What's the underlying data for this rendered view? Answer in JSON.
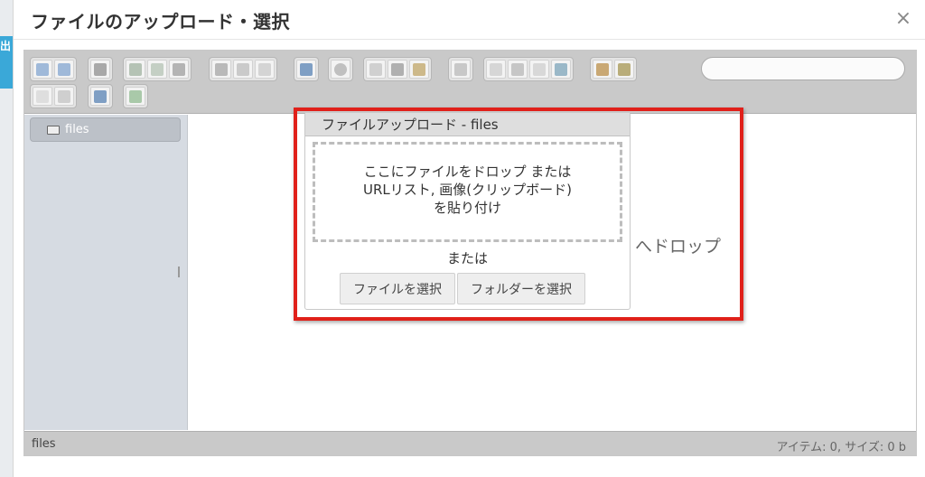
{
  "page": {
    "left_tab_text": "出"
  },
  "dialog": {
    "title": "ファイルのアップロード・選択",
    "close_label": "×"
  },
  "toolbar": {
    "search": {
      "value": "",
      "placeholder": ""
    },
    "groups": [
      [
        "back-icon",
        "forward-icon"
      ],
      [
        "home-icon"
      ],
      [
        "open-icon",
        "new-file-icon",
        "save-icon"
      ],
      [
        "view-icon",
        "save-all-icon",
        "select-icon"
      ],
      [
        "info-icon"
      ],
      [
        "preview-icon"
      ],
      [
        "copy-icon",
        "cut-icon",
        "paste-icon"
      ],
      [
        "duplicate-icon"
      ],
      [
        "rename-icon",
        "edit-icon",
        "file-icon",
        "resize-icon"
      ],
      [
        "extract-icon",
        "archive-icon"
      ],
      [
        "list-view-icon",
        "icon-view-icon"
      ],
      [
        "help-icon"
      ],
      [
        "fullscreen-icon"
      ]
    ]
  },
  "sidebar": {
    "root_label": "files"
  },
  "main": {
    "drop_hint": "へドロップ"
  },
  "upload_dialog": {
    "title": "ファイルアップロード - files",
    "drop_zone": {
      "line1": "ここにファイルをドロップ または",
      "line2": "URLリスト, 画像(クリップボード)",
      "line3": "を貼り付け"
    },
    "or_label": "または",
    "select_files_label": "ファイルを選択",
    "select_folder_label": "フォルダーを選択"
  },
  "status": {
    "path": "files",
    "info": "アイテム: 0, サイズ: 0 b"
  },
  "colors": {
    "highlight": "#e0201a",
    "toolbar_bg": "#c9c9c9",
    "sidebar_bg": "#d6dbe2",
    "tab_blue": "#3aa8d8"
  }
}
